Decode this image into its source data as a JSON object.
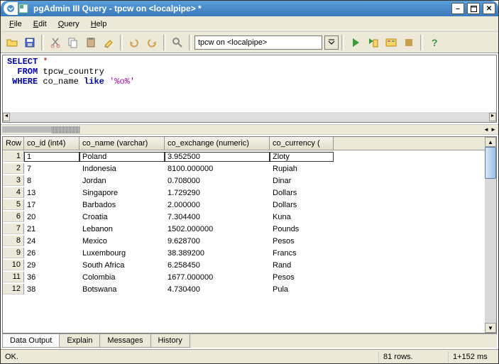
{
  "window": {
    "title": "pgAdmin III Query - tpcw on <localpipe> *"
  },
  "menubar": {
    "file": "File",
    "edit": "Edit",
    "query": "Query",
    "help": "Help"
  },
  "toolbar": {
    "connection": "tpcw on <localpipe>"
  },
  "query": {
    "kw_select": "SELECT",
    "star": "*",
    "kw_from": "FROM",
    "tbl": "tpcw_country",
    "kw_where": "WHERE",
    "col": "co_name",
    "kw_like": "like",
    "str": "'%o%'"
  },
  "grid": {
    "headers": {
      "row": "Row",
      "co_id": "co_id (int4)",
      "co_name": "co_name (varchar)",
      "co_exchange": "co_exchange (numeric)",
      "co_currency": "co_currency ("
    },
    "rows": [
      {
        "n": "1",
        "id": "1",
        "name": "Poland",
        "ex": "3.952500",
        "cur": "Zloty"
      },
      {
        "n": "2",
        "id": "7",
        "name": "Indonesia",
        "ex": "8100.000000",
        "cur": "Rupiah"
      },
      {
        "n": "3",
        "id": "8",
        "name": "Jordan",
        "ex": "0.708000",
        "cur": "Dinar"
      },
      {
        "n": "4",
        "id": "13",
        "name": "Singapore",
        "ex": "1.729290",
        "cur": "Dollars"
      },
      {
        "n": "5",
        "id": "17",
        "name": "Barbados",
        "ex": "2.000000",
        "cur": "Dollars"
      },
      {
        "n": "6",
        "id": "20",
        "name": "Croatia",
        "ex": "7.304400",
        "cur": "Kuna"
      },
      {
        "n": "7",
        "id": "21",
        "name": "Lebanon",
        "ex": "1502.000000",
        "cur": "Pounds"
      },
      {
        "n": "8",
        "id": "24",
        "name": "Mexico",
        "ex": "9.628700",
        "cur": "Pesos"
      },
      {
        "n": "9",
        "id": "26",
        "name": "Luxembourg",
        "ex": "38.389200",
        "cur": "Francs"
      },
      {
        "n": "10",
        "id": "29",
        "name": "South Africa",
        "ex": "6.258450",
        "cur": "Rand"
      },
      {
        "n": "11",
        "id": "36",
        "name": "Colombia",
        "ex": "1677.000000",
        "cur": "Pesos"
      },
      {
        "n": "12",
        "id": "38",
        "name": "Botswana",
        "ex": "4.730400",
        "cur": "Pula"
      }
    ]
  },
  "tabs": {
    "data_output": "Data Output",
    "explain": "Explain",
    "messages": "Messages",
    "history": "History"
  },
  "status": {
    "msg": "OK.",
    "rows": "81 rows.",
    "time": "1+152 ms"
  }
}
